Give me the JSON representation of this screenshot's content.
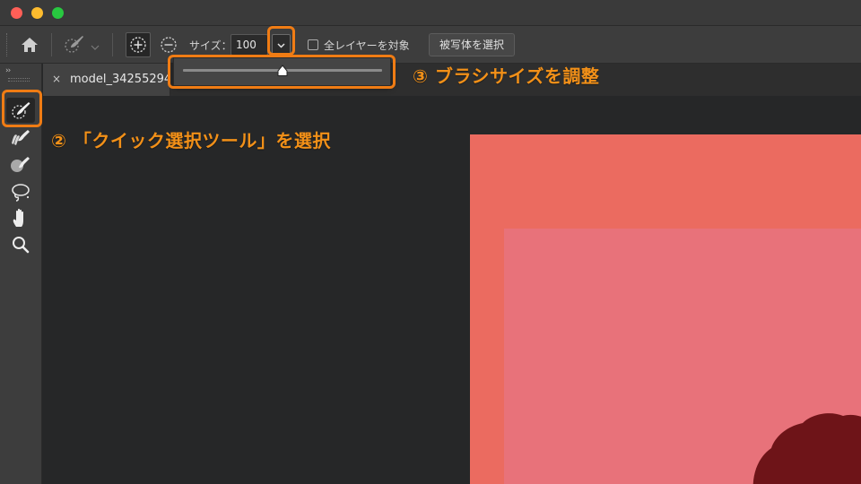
{
  "window": {
    "traffic_lights": [
      "close",
      "minimize",
      "zoom"
    ]
  },
  "options_bar": {
    "size_label": "サイズ：",
    "size_value": "100",
    "all_layers_label": "全レイヤーを対象",
    "all_layers_checked": false,
    "select_subject_label": "被写体を選択"
  },
  "toolbar": {
    "collapse_label": "››",
    "tools": [
      {
        "name": "quick-selection",
        "active": true
      },
      {
        "name": "refine-brush",
        "active": false
      },
      {
        "name": "paint-brush",
        "active": false
      },
      {
        "name": "lasso",
        "active": false
      },
      {
        "name": "hand",
        "active": false
      },
      {
        "name": "zoom",
        "active": false
      }
    ]
  },
  "document_tab": {
    "close_label": "×",
    "title": "model_34255294"
  },
  "size_popup": {
    "slider_value": 0.5
  },
  "annotations": {
    "step2": "② 「クイック選択ツール」を選択",
    "step3": "③ ブラシサイズを調整",
    "highlight_color": "#f07c14",
    "text_color": "#f29018"
  },
  "canvas": {
    "photo_outer_color": "#eb6b60",
    "photo_inner_color": "#e8727a",
    "hair_color": "#6e1418"
  }
}
